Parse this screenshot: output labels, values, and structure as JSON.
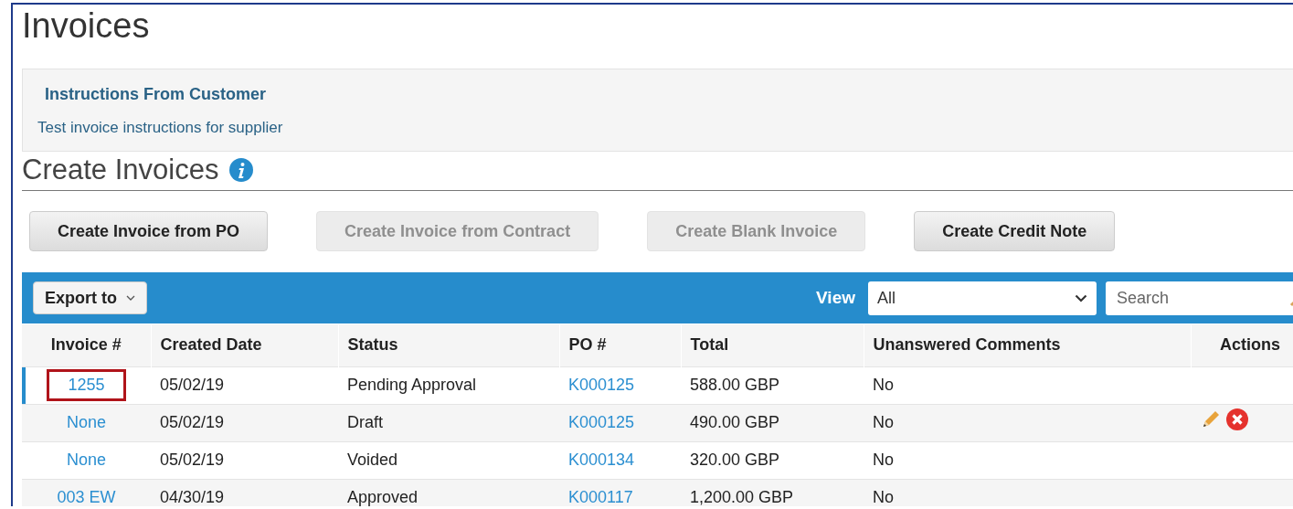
{
  "page_title": "Invoices",
  "instructions": {
    "heading": "Instructions From Customer",
    "text": "Test invoice instructions for supplier"
  },
  "section_title": "Create Invoices",
  "buttons": [
    {
      "label": "Create Invoice from PO",
      "disabled": false
    },
    {
      "label": "Create Invoice from Contract",
      "disabled": true
    },
    {
      "label": "Create Blank Invoice",
      "disabled": true
    },
    {
      "label": "Create Credit Note",
      "disabled": false
    }
  ],
  "toolbar": {
    "export_label": "Export to",
    "view_label": "View",
    "view_value": "All",
    "search_placeholder": "Search"
  },
  "table": {
    "columns": [
      "Invoice #",
      "Created Date",
      "Status",
      "PO #",
      "Total",
      "Unanswered Comments",
      "Actions"
    ],
    "rows": [
      {
        "invoice": "1255",
        "created": "05/02/19",
        "status": "Pending Approval",
        "po": "K000125",
        "total": "588.00 GBP",
        "comments": "No",
        "selected": true,
        "highlighted": true,
        "editable": false
      },
      {
        "invoice": "None",
        "created": "05/02/19",
        "status": "Draft",
        "po": "K000125",
        "total": "490.00 GBP",
        "comments": "No",
        "selected": false,
        "highlighted": false,
        "editable": true
      },
      {
        "invoice": "None",
        "created": "05/02/19",
        "status": "Voided",
        "po": "K000134",
        "total": "320.00 GBP",
        "comments": "No",
        "selected": false,
        "highlighted": false,
        "editable": false
      },
      {
        "invoice": "003 EW",
        "created": "04/30/19",
        "status": "Approved",
        "po": "K000117",
        "total": "1,200.00 GBP",
        "comments": "No",
        "selected": false,
        "highlighted": false,
        "editable": false
      }
    ]
  }
}
